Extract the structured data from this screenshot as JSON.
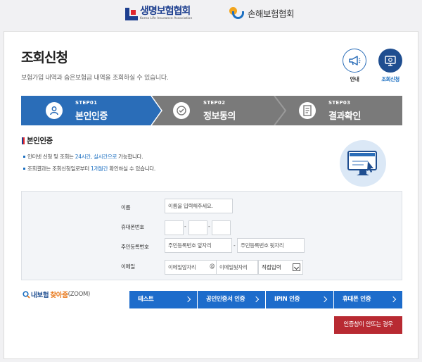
{
  "header": {
    "logo_life_ko": "생명보험협회",
    "logo_life_en": "Korea Life Insurance Association",
    "logo_nonlife_ko": "손해보험협회"
  },
  "page": {
    "title": "조회신청",
    "description": "보험가입 내역과 숨은보험금 내역을 조회하실 수 있습니다."
  },
  "quick": {
    "guide_label": "안내",
    "apply_label": "조회신청"
  },
  "steps": [
    {
      "num": "STEP01",
      "name": "본인인증",
      "active": true
    },
    {
      "num": "STEP02",
      "name": "정보동의",
      "active": false
    },
    {
      "num": "STEP03",
      "name": "결과확인",
      "active": false
    }
  ],
  "section": {
    "title": "본인인증",
    "bullet1_pre": "인터넷 신청 및 조회는 ",
    "bullet1_hl": "24시간, 실시간으로",
    "bullet1_post": " 가능합니다.",
    "bullet2_pre": "조회결과는 조회신청일로부터 ",
    "bullet2_hl": "1개월간",
    "bullet2_post": " 확인하실 수 있습니다."
  },
  "form": {
    "name_label": "이름",
    "name_placeholder": "이름을 입력해주세요.",
    "phone_label": "휴대폰번호",
    "phone_sep": "-",
    "rrn_label": "주민등록번호",
    "rrn_front_placeholder": "주민등록번호 앞자리",
    "rrn_back_placeholder": "주민등록번호 뒷자리",
    "rrn_sep": "-",
    "email_label": "이메일",
    "email_id_placeholder": "이메일앞자리",
    "email_at": "@",
    "email_domain_placeholder": "이메일뒷자리",
    "email_select": "직접입력"
  },
  "zoom": {
    "part1": "내보험",
    "part2": "찾아줌",
    "part3": "(ZOOM)"
  },
  "auth_buttons": {
    "test": "테스트",
    "cert": "공인인증서 인증",
    "ipin": "IPIN 인증",
    "phone": "휴대폰 인증"
  },
  "popup_help": "인증창이 안뜨는 경우",
  "colors": {
    "active_step": "#2a6db8",
    "inactive_step": "#7a7a7a",
    "button_blue": "#1d6ccb",
    "button_red": "#b82a32"
  }
}
